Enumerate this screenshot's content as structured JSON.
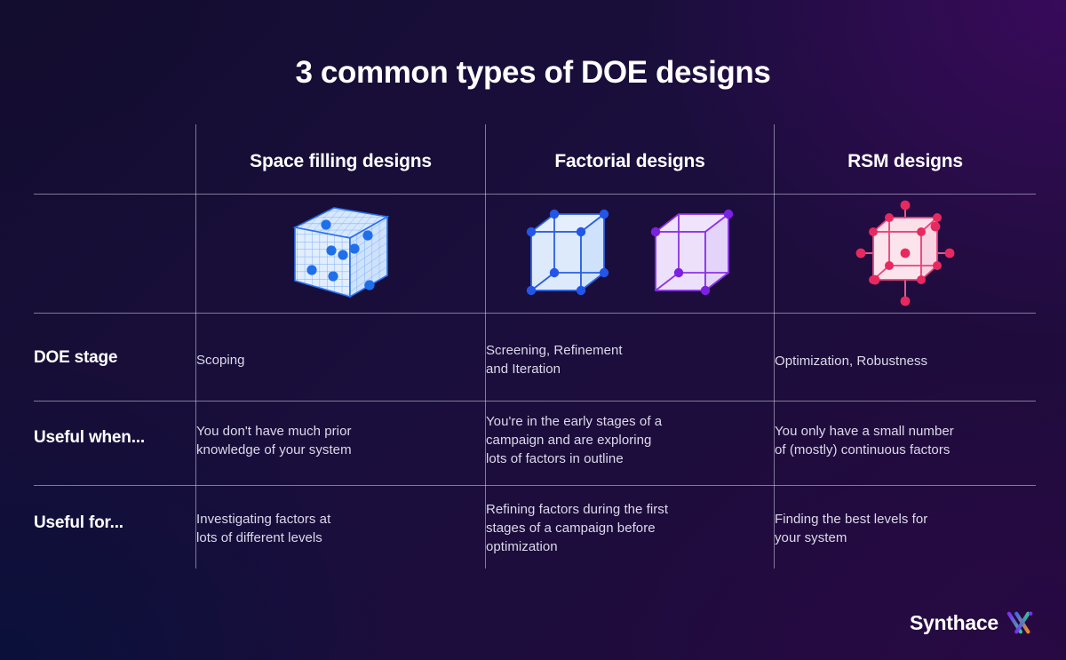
{
  "title": "3 common types of DOE designs",
  "columns": [
    {
      "id": "space-filling",
      "header": "Space filling designs"
    },
    {
      "id": "factorial",
      "header": "Factorial designs"
    },
    {
      "id": "rsm",
      "header": "RSM designs"
    }
  ],
  "rows": [
    {
      "label": "DOE stage",
      "cells": [
        "Scoping",
        "Screening, Refinement\nand Iteration",
        "Optimization, Robustness"
      ]
    },
    {
      "label": "Useful when...",
      "cells": [
        "You don't have much prior\nknowledge of your system",
        "You're in the early stages of a\ncampaign and are exploring\nlots of factors in outline",
        "You only have a small number\nof (mostly) continuous factors"
      ]
    },
    {
      "label": "Useful for...",
      "cells": [
        "Investigating factors at\nlots of different levels",
        "Refining factors during the first\nstages of a campaign before\noptimization",
        "Finding the best levels for\nyour system"
      ]
    }
  ],
  "diagrams": {
    "space_filling": {
      "name": "space-filling-cube",
      "description": "mesh grid cube with scattered interior points",
      "edge_color": "#2b6ff0",
      "face_color": "#dbe9fd",
      "point_color": "#1f6feb",
      "point_count": 8
    },
    "factorial_blue": {
      "name": "factorial-cube-blue",
      "description": "full factorial cube with points at all 8 vertices",
      "edge_color": "#2b5fe0",
      "face_color": "#dfeafc",
      "point_color": "#2255e8",
      "point_count": 8
    },
    "factorial_purple": {
      "name": "factorial-cube-purple",
      "description": "fractional factorial cube with points at 4 alternating vertices",
      "edge_color": "#8b32e8",
      "face_color": "#ece0fb",
      "point_color": "#7a22e0",
      "point_count": 4
    },
    "rsm": {
      "name": "rsm-central-composite-cube",
      "description": "central composite design: 8 cube vertices, 1 centre point, 6 axial star points",
      "edge_color": "#e8437a",
      "face_color": "#fbdfe9",
      "point_color": "#e8295f",
      "point_count": 15
    }
  },
  "logo": {
    "text": "Synthace",
    "mark_name": "synthace-logo-mark",
    "mark_colors": [
      "#7b2ff7",
      "#3c6df0",
      "#2fc98e",
      "#f08a24",
      "#e8295f"
    ]
  },
  "colors": {
    "background_top_left": "#150e33",
    "background_top_right": "#230a3a",
    "background_bottom_left": "#0b1138",
    "divider": "#d6d4e8",
    "heading_text": "#ffffff",
    "body_text": "#ddd9ea"
  }
}
